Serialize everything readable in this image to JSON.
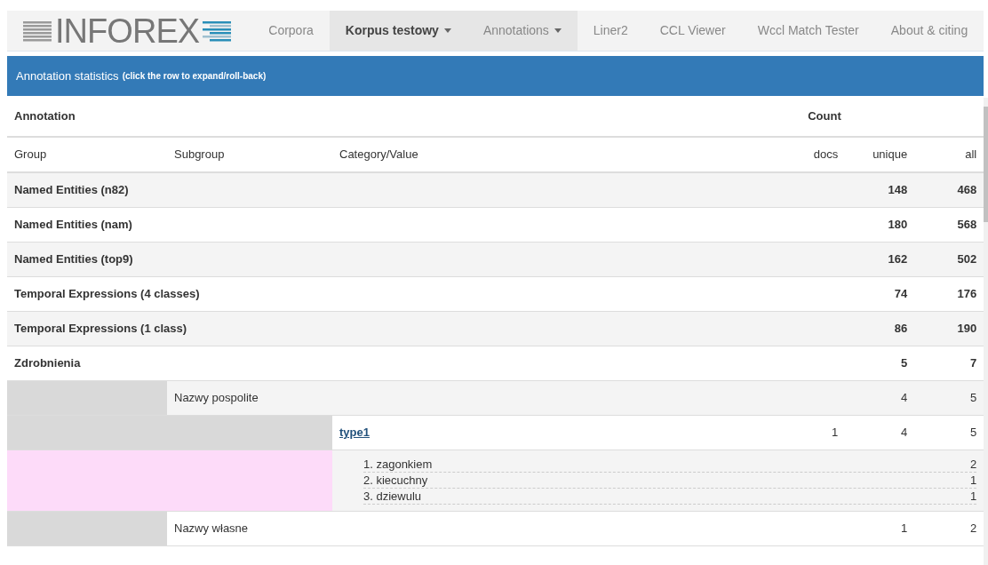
{
  "navbar": {
    "logo": "INFOREX",
    "items": [
      {
        "label": "Corpora",
        "selected": false,
        "highlighted": false,
        "dropdown": false
      },
      {
        "label": "Korpus testowy",
        "selected": true,
        "highlighted": true,
        "dropdown": true
      },
      {
        "label": "Annotations",
        "selected": false,
        "highlighted": true,
        "dropdown": true
      },
      {
        "label": "Liner2",
        "selected": false,
        "highlighted": false,
        "dropdown": false
      },
      {
        "label": "CCL Viewer",
        "selected": false,
        "highlighted": false,
        "dropdown": false
      },
      {
        "label": "Wccl Match Tester",
        "selected": false,
        "highlighted": false,
        "dropdown": false
      },
      {
        "label": "About & citing",
        "selected": false,
        "highlighted": false,
        "dropdown": false
      }
    ]
  },
  "panel": {
    "title": "Annotation statistics",
    "hint": "(click the row to expand/roll-back)"
  },
  "table": {
    "header_top": [
      "Annotation",
      "Count"
    ],
    "columns": [
      "Group",
      "Subgroup",
      "Category/Value",
      "docs",
      "unique",
      "all"
    ],
    "rows": [
      {
        "kind": "group",
        "name": "Named Entities (n82)",
        "unique": "148",
        "all": "468"
      },
      {
        "kind": "group",
        "name": "Named Entities (nam)",
        "unique": "180",
        "all": "568"
      },
      {
        "kind": "group",
        "name": "Named Entities (top9)",
        "unique": "162",
        "all": "502"
      },
      {
        "kind": "group",
        "name": "Temporal Expressions (4 classes)",
        "unique": "74",
        "all": "176"
      },
      {
        "kind": "group",
        "name": "Temporal Expressions (1 class)",
        "unique": "86",
        "all": "190"
      },
      {
        "kind": "group",
        "name": "Zdrobnienia",
        "unique": "5",
        "all": "7"
      },
      {
        "kind": "subgroup",
        "name": "Nazwy pospolite",
        "unique": "4",
        "all": "5"
      },
      {
        "kind": "category",
        "name": "type1",
        "docs": "1",
        "unique": "4",
        "all": "5"
      },
      {
        "kind": "values",
        "values": [
          {
            "text": "1. zagonkiem",
            "all": "2"
          },
          {
            "text": "2. kiecuchny",
            "all": "1"
          },
          {
            "text": "3. dziewulu",
            "all": "1"
          }
        ]
      },
      {
        "kind": "subgroup",
        "name": "Nazwy własne",
        "unique": "1",
        "all": "2"
      }
    ]
  }
}
